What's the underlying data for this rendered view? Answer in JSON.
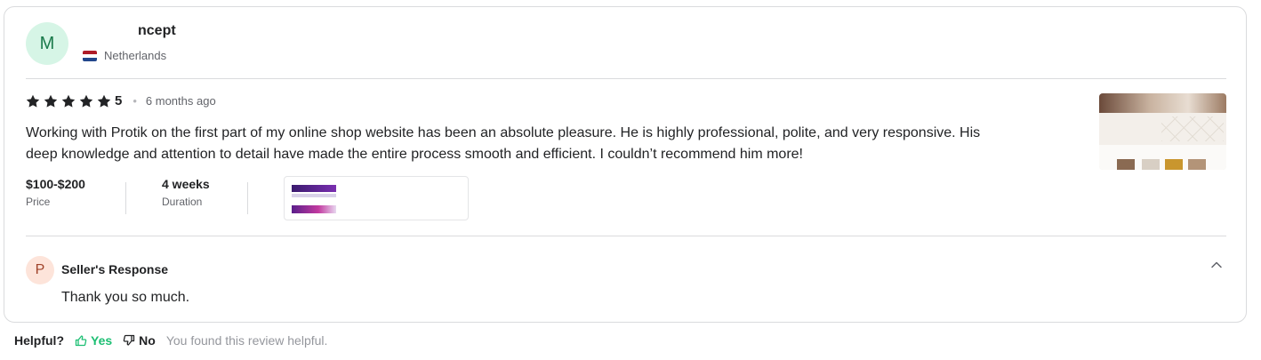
{
  "reviewer": {
    "avatar_letter": "M",
    "name_visible": "ncept",
    "country": "Netherlands"
  },
  "review": {
    "rating": "5",
    "stars": 5,
    "separator": "•",
    "time_ago": "6 months ago",
    "text": "Working with Protik on the first part of my online shop website has been an absolute pleasure. He is highly professional, polite, and very responsive. His deep knowledge and attention to detail have made the entire process smooth and efficient. I couldn’t recommend him more!",
    "price_value": "$100-$200",
    "price_label": "Price",
    "duration_value": "4 weeks",
    "duration_label": "Duration"
  },
  "seller_response": {
    "avatar_letter": "P",
    "title": "Seller's Response",
    "text": "Thank you so much."
  },
  "helpful": {
    "question": "Helpful?",
    "yes_label": "Yes",
    "no_label": "No",
    "note": "You found this review helpful."
  },
  "colors": {
    "star": "#222325",
    "yes": "#1dbf73",
    "muted": "#62646a",
    "border": "#dadbdd"
  },
  "icons": {
    "star": "star-icon",
    "flag": "netherlands-flag-icon",
    "chevron": "chevron-up-icon",
    "thumbs_up": "thumbs-up-icon",
    "thumbs_down": "thumbs-down-icon"
  }
}
